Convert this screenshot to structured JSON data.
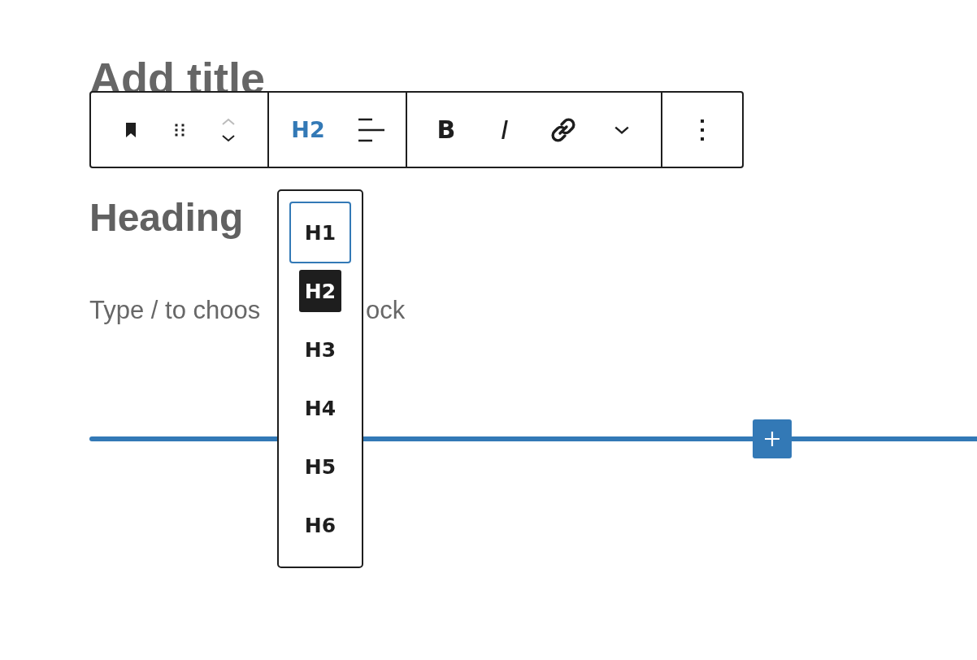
{
  "editor": {
    "title": "Add title",
    "heading": "Heading",
    "paragraph": {
      "placeholder_left": "Type / to choos",
      "placeholder_right": "ock"
    }
  },
  "toolbar": {
    "groups": [
      {
        "items": [
          {
            "kind": "block-type"
          },
          {
            "kind": "drag"
          },
          {
            "kind": "mover",
            "up_disabled": true,
            "down_disabled": false
          }
        ]
      },
      {
        "items": [
          {
            "kind": "heading-level",
            "label": "H2",
            "expanded": true
          },
          {
            "kind": "align"
          }
        ]
      },
      {
        "items": [
          {
            "kind": "bold",
            "label": "B"
          },
          {
            "kind": "italic",
            "label": "I"
          },
          {
            "kind": "link"
          },
          {
            "kind": "more"
          }
        ]
      },
      {
        "items": [
          {
            "kind": "options"
          }
        ]
      }
    ]
  },
  "heading_menu": {
    "items": [
      {
        "label": "H1",
        "focused": true,
        "selected": false
      },
      {
        "label": "H2",
        "focused": false,
        "selected": true
      },
      {
        "label": "H3",
        "focused": false,
        "selected": false
      },
      {
        "label": "H4",
        "focused": false,
        "selected": false
      },
      {
        "label": "H5",
        "focused": false,
        "selected": false
      },
      {
        "label": "H6",
        "focused": false,
        "selected": false
      }
    ]
  }
}
